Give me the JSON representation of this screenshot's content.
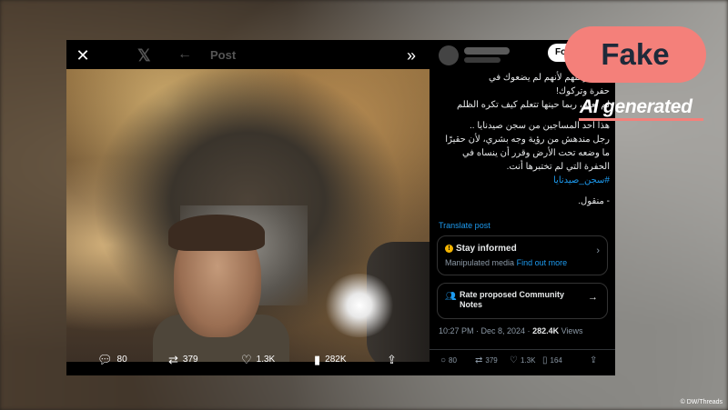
{
  "viewer": {
    "header_label": "Post",
    "actions": {
      "replies": "80",
      "reposts": "379",
      "likes": "1.3K",
      "views": "282K"
    }
  },
  "post": {
    "follow_label": "Fo",
    "text_lines": [
      "فهم فرحتهم لأنهم لم يضعوك في",
      "حفرة وتركوك!",
      "لم نعلم، ربما حينها تتعلم كيف تكره الظلم",
      "هذا أحد المساجين من سجن صيدنايا ..",
      "رجل مندهش من رؤية وجه بشري، لأن حقيرًا",
      "ما وضعه تحت الأرض وقرر أن ينساه في",
      "الحفرة التي لم تختبرها أنت.",
      "#سجن_صيدنايا",
      "- منقول."
    ],
    "translate_label": "Translate post",
    "stay_informed": {
      "title": "Stay informed",
      "subtitle": "Manipulated media",
      "link": "Find out more"
    },
    "community_notes": {
      "title": "Rate proposed Community Notes"
    },
    "meta": {
      "time": "10:27 PM · Dec 8, 2024 · ",
      "views_count": "282.4K",
      "views_label": " Views"
    },
    "actions": {
      "replies": "80",
      "reposts": "379",
      "likes": "1.3K",
      "bookmarks": "164"
    }
  },
  "overlay": {
    "fake_label": "Fake",
    "ai_label": "AI generated",
    "credit": "© DW/Threads",
    "badge_color": "#f4807a"
  }
}
